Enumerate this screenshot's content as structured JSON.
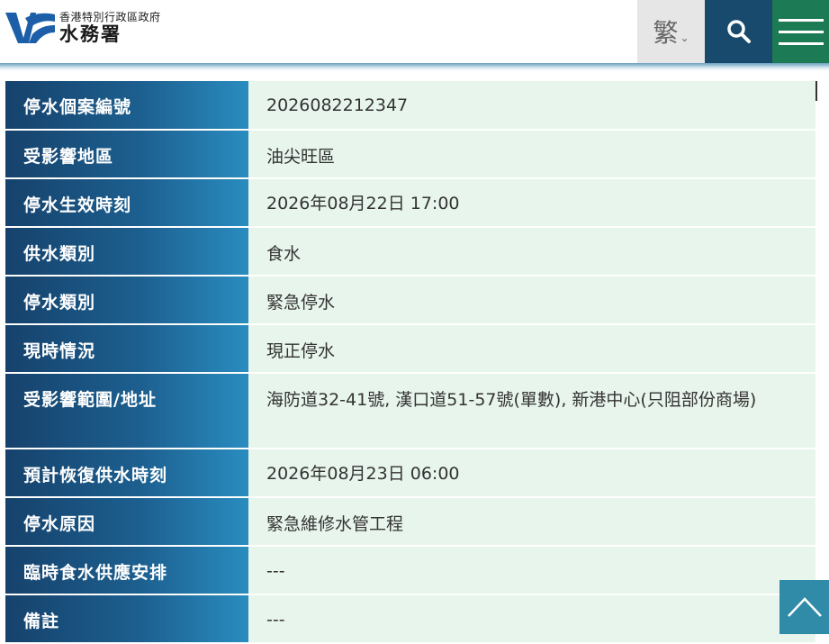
{
  "header": {
    "logo_subtitle": "香港特別行政區政府",
    "logo_title": "水務署",
    "language_label": "繁",
    "language_chevron": "⌄",
    "search_icon": "search-icon",
    "menu_icon": "hamburger-menu-icon",
    "colors": {
      "search_bg": "#174a6c",
      "menu_bg": "#1c7a54",
      "lang_bg": "#e6e6e6",
      "logo_blue": "#1c5fa8"
    }
  },
  "details": {
    "case_no": {
      "label": "停水個案編號",
      "value": "2026082212347"
    },
    "district": {
      "label": "受影響地區",
      "value": "油尖旺區"
    },
    "effective_time": {
      "label": "停水生效時刻",
      "value": "2026年08月22日 17:00"
    },
    "supply_type": {
      "label": "供水類別",
      "value": "食水"
    },
    "suspension_type": {
      "label": "停水類別",
      "value": "緊急停水"
    },
    "current_status": {
      "label": "現時情況",
      "value": "現正停水"
    },
    "affected_area": {
      "label": "受影響範圍/地址",
      "value": "海防道32-41號, 漢口道51-57號(單數), 新港中心(只阻部份商場)"
    },
    "restore_time": {
      "label": "預計恢復供水時刻",
      "value": "2026年08月23日 06:00"
    },
    "reason": {
      "label": "停水原因",
      "value": "緊急維修水管工程"
    },
    "temp_arrangement": {
      "label": "臨時食水供應安排",
      "value": "---"
    },
    "remarks": {
      "label": "備註",
      "value": "---"
    }
  },
  "back_to_top_icon": "chevron-up-icon"
}
